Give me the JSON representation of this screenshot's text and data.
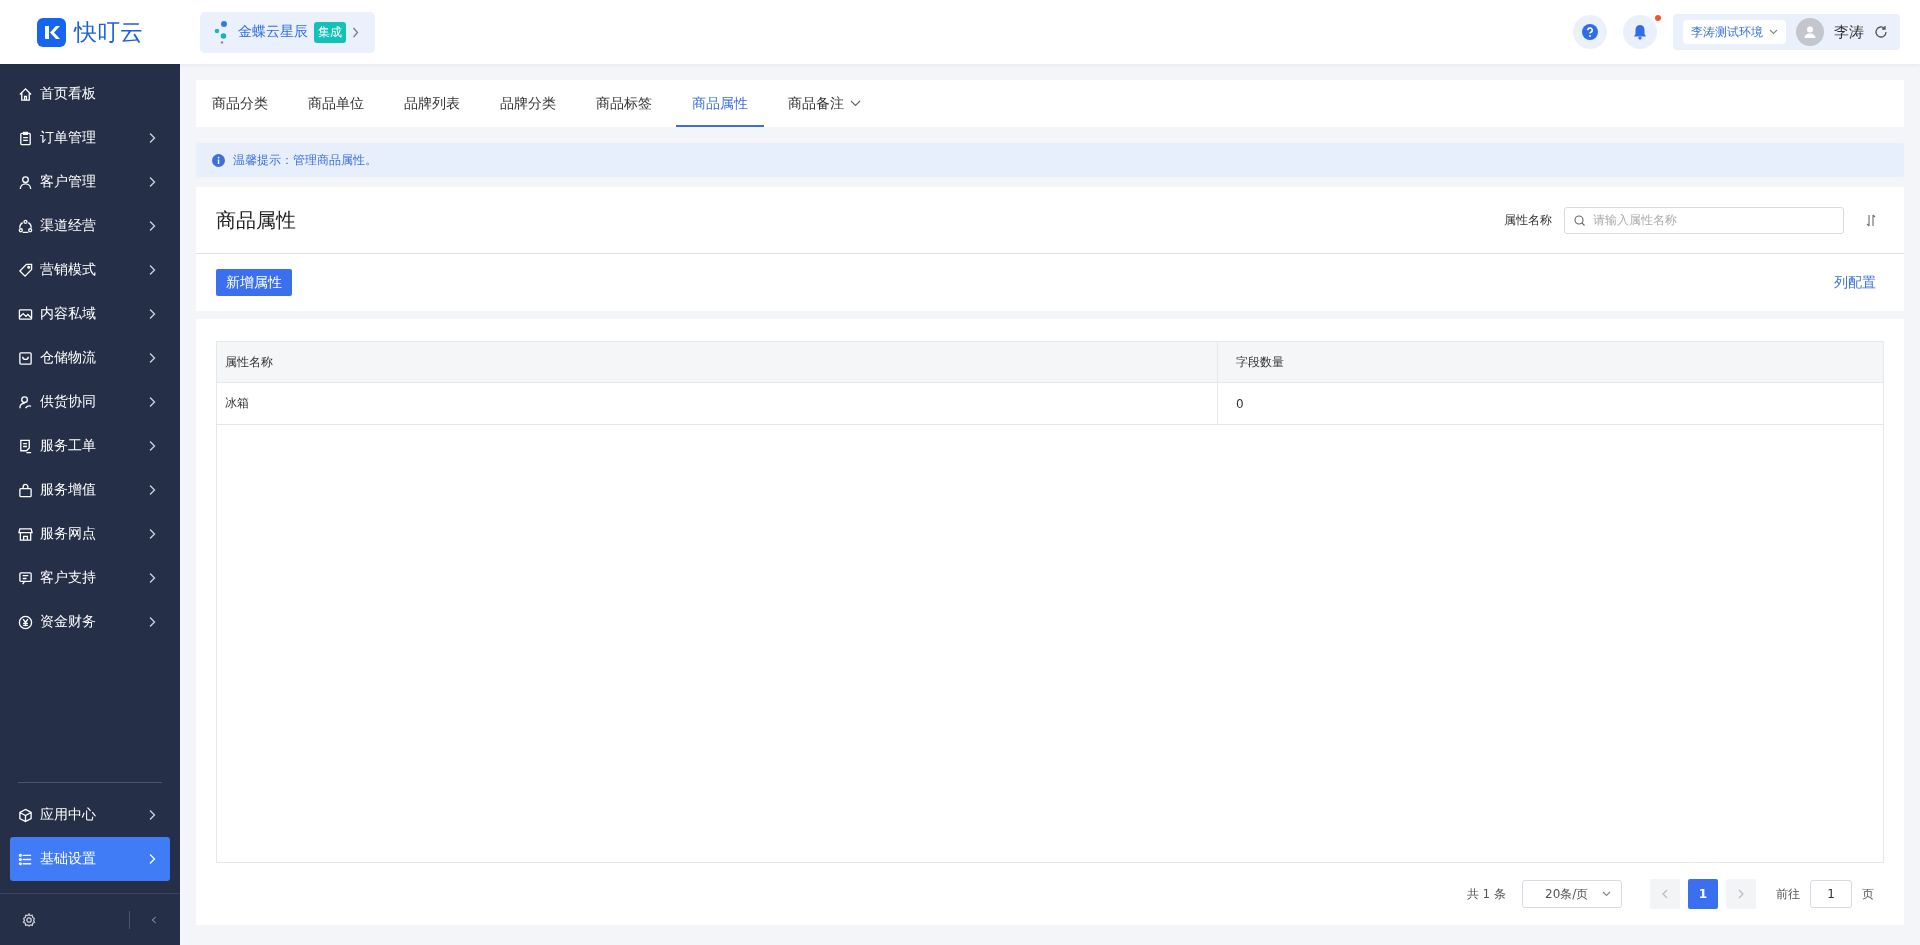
{
  "header": {
    "logo_text": "快叮云",
    "app_chip": {
      "label": "金蝶云星辰",
      "badge": "集成"
    },
    "notification_unread": true,
    "environment": "李涛测试环境",
    "user_name": "李涛"
  },
  "sidebar": {
    "items": [
      {
        "label": "首页看板",
        "expandable": false,
        "selected": false
      },
      {
        "label": "订单管理",
        "expandable": true,
        "selected": false
      },
      {
        "label": "客户管理",
        "expandable": true,
        "selected": false
      },
      {
        "label": "渠道经营",
        "expandable": true,
        "selected": false
      },
      {
        "label": "营销模式",
        "expandable": true,
        "selected": false
      },
      {
        "label": "内容私域",
        "expandable": true,
        "selected": false
      },
      {
        "label": "仓储物流",
        "expandable": true,
        "selected": false
      },
      {
        "label": "供货协同",
        "expandable": true,
        "selected": false
      },
      {
        "label": "服务工单",
        "expandable": true,
        "selected": false
      },
      {
        "label": "服务增值",
        "expandable": true,
        "selected": false
      },
      {
        "label": "服务网点",
        "expandable": true,
        "selected": false
      },
      {
        "label": "客户支持",
        "expandable": true,
        "selected": false
      },
      {
        "label": "资金财务",
        "expandable": true,
        "selected": false
      }
    ],
    "bottom_items": [
      {
        "label": "应用中心",
        "expandable": true,
        "selected": false
      },
      {
        "label": "基础设置",
        "expandable": true,
        "selected": true
      }
    ]
  },
  "tabs": [
    {
      "label": "商品分类",
      "selected": false,
      "has_menu": false
    },
    {
      "label": "商品单位",
      "selected": false,
      "has_menu": false
    },
    {
      "label": "品牌列表",
      "selected": false,
      "has_menu": false
    },
    {
      "label": "品牌分类",
      "selected": false,
      "has_menu": false
    },
    {
      "label": "商品标签",
      "selected": false,
      "has_menu": false
    },
    {
      "label": "商品属性",
      "selected": true,
      "has_menu": false
    },
    {
      "label": "商品备注",
      "selected": false,
      "has_menu": true
    }
  ],
  "notice": "温馨提示：管理商品属性。",
  "page_title": "商品属性",
  "filter": {
    "label": "属性名称",
    "placeholder": "请输入属性名称"
  },
  "add_button": "新增属性",
  "column_config_link": "列配置",
  "table": {
    "columns": [
      "属性名称",
      "字段数量"
    ],
    "rows": [
      [
        "冰箱",
        "0"
      ]
    ]
  },
  "pagination": {
    "total": "共 1 条",
    "page_size": "20条/页",
    "pages": [
      {
        "label": "1",
        "selected": true
      }
    ],
    "goto_label": "前往",
    "goto_value": "1",
    "goto_suffix": "页"
  }
}
